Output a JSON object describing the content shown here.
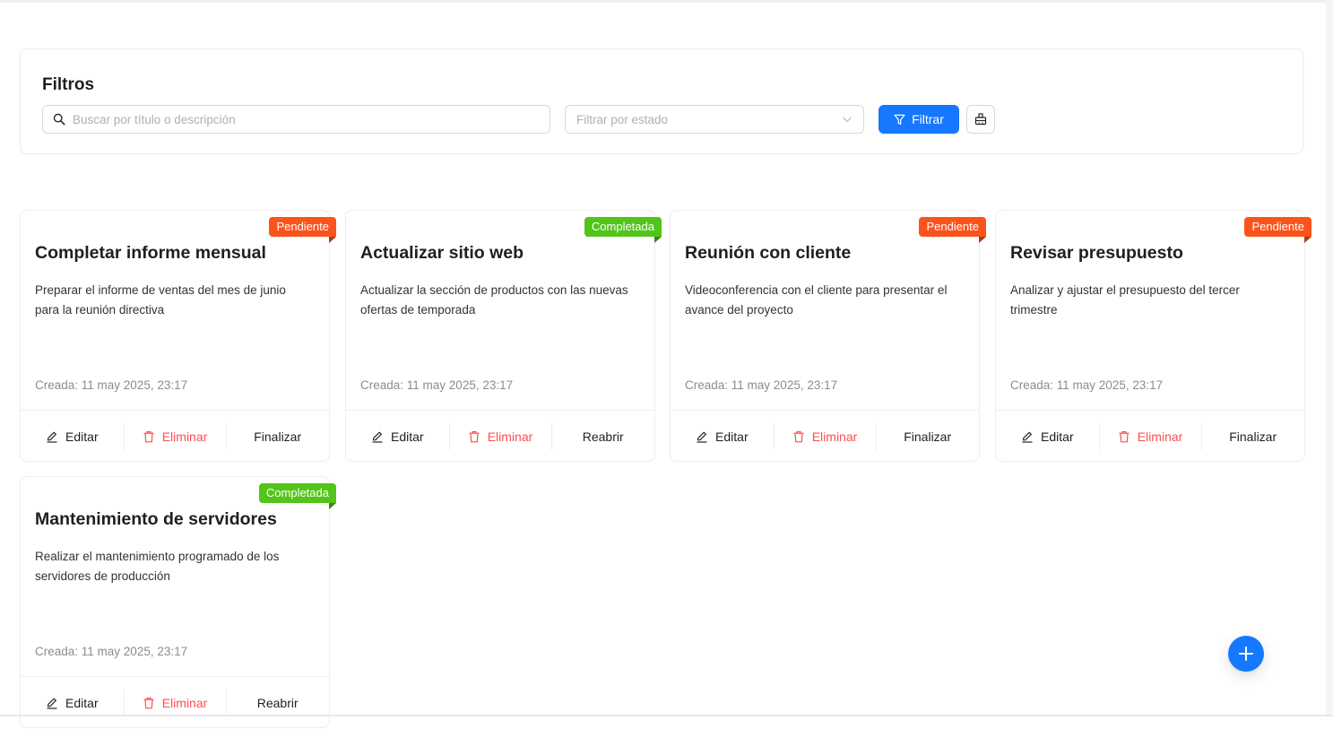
{
  "filters": {
    "title": "Filtros",
    "search_placeholder": "Buscar por título o descripción",
    "status_placeholder": "Filtrar por estado",
    "filter_button_label": "Filtrar"
  },
  "colors": {
    "primary": "#1677ff",
    "pending": "#fa541c",
    "completed": "#52c41a",
    "danger": "#ff4d4f"
  },
  "actions": {
    "edit_label": "Editar",
    "delete_label": "Eliminar",
    "finish_label": "Finalizar",
    "reopen_label": "Reabrir"
  },
  "tasks": [
    {
      "status": "Pendiente",
      "title": "Completar informe mensual",
      "description": "Preparar el informe de ventas del mes de junio para la reunión directiva",
      "created": "Creada: 11 may 2025, 23:17",
      "toggle_label": "Finalizar"
    },
    {
      "status": "Completada",
      "title": "Actualizar sitio web",
      "description": "Actualizar la sección de productos con las nuevas ofertas de temporada",
      "created": "Creada: 11 may 2025, 23:17",
      "toggle_label": "Reabrir"
    },
    {
      "status": "Pendiente",
      "title": "Reunión con cliente",
      "description": "Videoconferencia con el cliente para presentar el avance del proyecto",
      "created": "Creada: 11 may 2025, 23:17",
      "toggle_label": "Finalizar"
    },
    {
      "status": "Pendiente",
      "title": "Revisar presupuesto",
      "description": "Analizar y ajustar el presupuesto del tercer trimestre",
      "created": "Creada: 11 may 2025, 23:17",
      "toggle_label": "Finalizar"
    },
    {
      "status": "Completada",
      "title": "Mantenimiento de servidores",
      "description": "Realizar el mantenimiento programado de los servidores de producción",
      "created": "Creada: 11 may 2025, 23:17",
      "toggle_label": "Reabrir"
    }
  ]
}
